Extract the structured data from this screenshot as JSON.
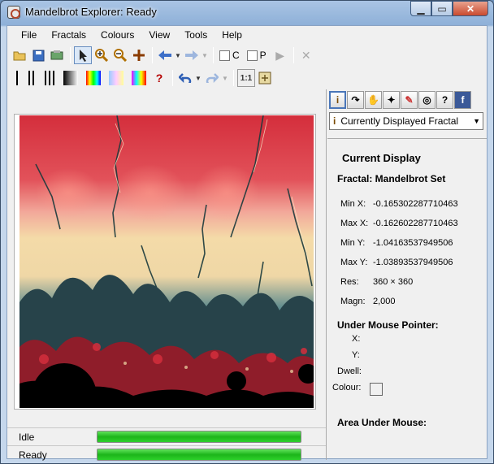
{
  "window": {
    "title": "Mandelbrot Explorer: Ready"
  },
  "menu": [
    "File",
    "Fractals",
    "Colours",
    "View",
    "Tools",
    "Help"
  ],
  "toolbar": {
    "c_label": "C",
    "p_label": "P",
    "ratio_label": "1:1",
    "help_glyph": "?"
  },
  "right_panel": {
    "combo_value": "Currently Displayed Fractal",
    "heading": "Current Display",
    "fractal_line": "Fractal: Mandelbrot Set",
    "fields": [
      {
        "label": "Min X:",
        "value": "-0.165302287710463"
      },
      {
        "label": "Max X:",
        "value": "-0.162602287710463"
      },
      {
        "label": "Min Y:",
        "value": "-1.04163537949506"
      },
      {
        "label": "Max Y:",
        "value": "-1.03893537949506"
      },
      {
        "label": "Res:",
        "value": "360 × 360"
      },
      {
        "label": "Magn:",
        "value": "2,000"
      }
    ],
    "mouse_heading": "Under Mouse Pointer:",
    "mouse_x": "X:",
    "mouse_y": "Y:",
    "dwell": "Dwell:",
    "colour": "Colour:",
    "area_heading": "Area Under Mouse:"
  },
  "status": [
    {
      "label": "Idle",
      "progress": 1.0
    },
    {
      "label": "Ready",
      "progress": 1.0
    }
  ],
  "colors": {
    "accent": "#1cb51a",
    "red": "#d4313c",
    "cream": "#f0dca6",
    "teal": "#3d6a72"
  }
}
